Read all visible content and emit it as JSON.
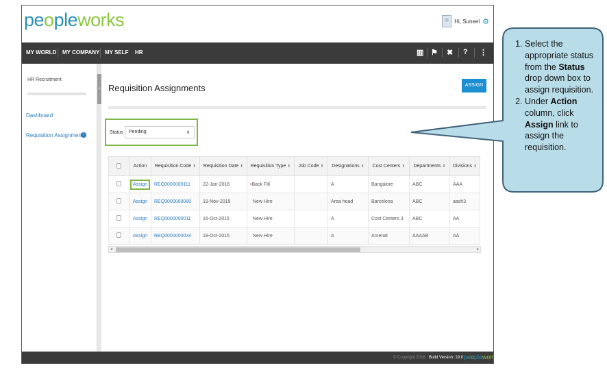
{
  "brand": {
    "part1": "pe",
    "part2": "o",
    "part3": "ple",
    "part4": "w",
    "part5": "o",
    "part6": "rks"
  },
  "header": {
    "greeting": "Hi, Suneel"
  },
  "nav": {
    "items": [
      {
        "label": "MY WORLD"
      },
      {
        "label": "MY COMPANY"
      },
      {
        "label": "MY SELF"
      },
      {
        "label": "HR"
      }
    ],
    "icons": [
      "book-icon",
      "pin-icon",
      "tools-icon",
      "help-icon",
      "share-icon"
    ]
  },
  "sidebar": {
    "title": "HR Recruitment",
    "items": [
      {
        "label": "Dashboard"
      },
      {
        "label": "Requisition Assignments"
      }
    ]
  },
  "main": {
    "title": "Requisition Assignments",
    "assign_button": "ASSIGN",
    "status_label": "Status",
    "status_value": "Pending"
  },
  "table": {
    "columns": [
      "Action",
      "Requisition Code",
      "Requisition Date",
      "Requisition Type",
      "Job Code",
      "Designations",
      "Cost Centers",
      "Departments",
      "Divisions"
    ],
    "rows": [
      {
        "action": "Assign",
        "code": "REQ0000000111",
        "date": "22-Jan-2016",
        "type": "Back Fill",
        "job": "",
        "designation": "A",
        "cost_center": "Bangalore",
        "department": "ABC",
        "division": "AAA"
      },
      {
        "action": "Assign",
        "code": "REQ0000000080",
        "date": "19-Nov-2015",
        "type": "New Hire",
        "job": "",
        "designation": "Area head",
        "cost_center": "Barcelona",
        "department": "ABC",
        "division": "aash3"
      },
      {
        "action": "Assign",
        "code": "REQ0000000011",
        "date": "16-Oct-2015",
        "type": "New Hire",
        "job": "",
        "designation": "A",
        "cost_center": "Cost Centers 3",
        "department": "ABC",
        "division": "AA"
      },
      {
        "action": "Assign",
        "code": "REQ0000000034",
        "date": "19-Oct-2015",
        "type": "New Hire",
        "job": "",
        "designation": "A",
        "cost_center": "Arsenal",
        "department": "AAAAB",
        "division": "AA"
      }
    ]
  },
  "footer": {
    "copyright": "© Copyright 2016",
    "build": "Build Version: 19.0"
  },
  "callout": {
    "step1_a": "Select the appropriate status from the ",
    "step1_b": "Status",
    "step1_c": " drop down box to assign requisition.",
    "step2_a": "Under ",
    "step2_b": "Action",
    "step2_c": " column, click ",
    "step2_d": "Assign",
    "step2_e": " link to assign the requisition."
  },
  "colors": {
    "brand_blue": "#2a91b3",
    "brand_green": "#8cc63f",
    "nav_dark": "#3b3b3b",
    "accent_button": "#1d8fd0",
    "highlight_green": "#7fb547",
    "callout_fill": "#b9dde8",
    "callout_border": "#41627a"
  }
}
